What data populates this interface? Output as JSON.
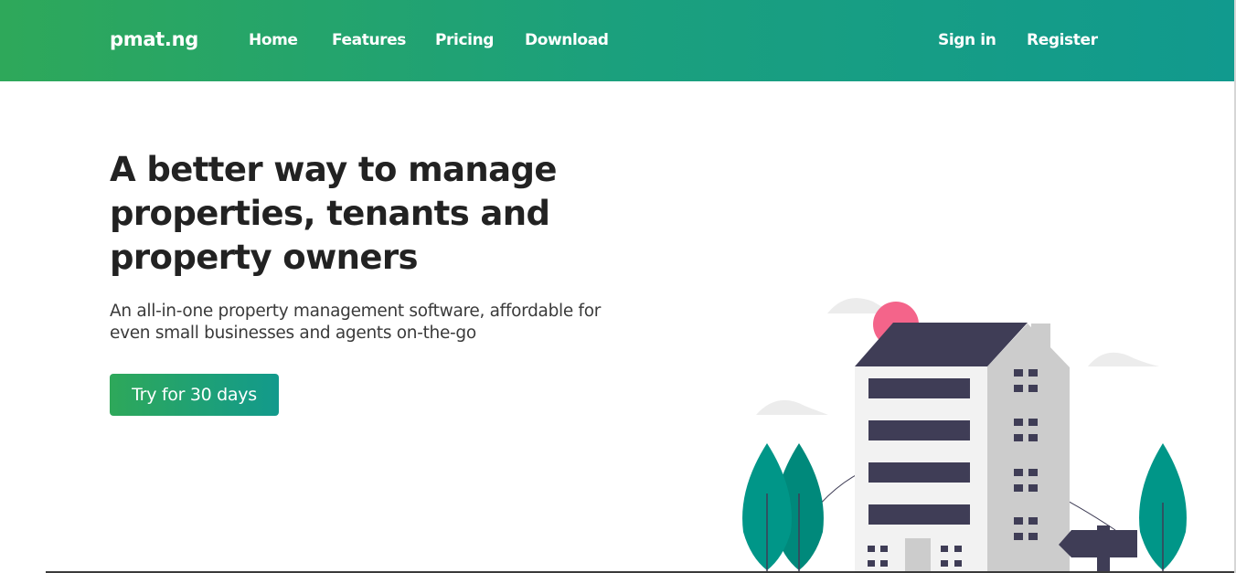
{
  "navbar": {
    "brand": "pmat.ng",
    "links": [
      "Home",
      "Features",
      "Pricing",
      "Download"
    ],
    "auth": {
      "signin": "Sign in",
      "register": "Register"
    },
    "gradient": [
      "#2ea85a",
      "#119a8e"
    ]
  },
  "hero": {
    "title_lines": [
      "A better way to manage",
      "properties, tenants and",
      "property owners"
    ],
    "subtitle_lines": [
      "An all-in-one property management software, affordable for",
      "even small businesses and agents on-the-go"
    ],
    "cta": "Try for 30 days"
  },
  "illustration": {
    "name": "apartment-building-illustration",
    "colors": {
      "roof": "#3f3d56",
      "sun": "#f4648a",
      "tree": "#009688",
      "tree_dark": "#00897b",
      "wall": "#f2f2f2",
      "side_wall": "#cccccc",
      "cloud": "#ececec"
    }
  }
}
